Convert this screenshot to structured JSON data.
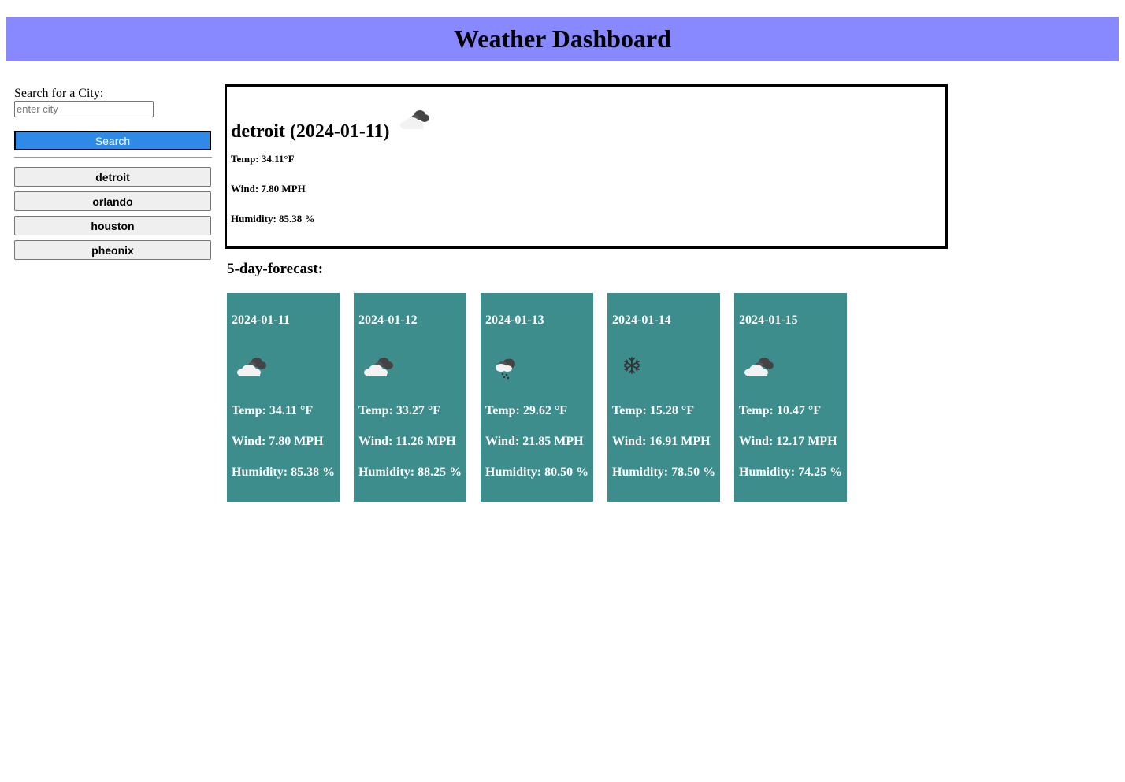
{
  "header": {
    "title": "Weather Dashboard"
  },
  "sidebar": {
    "search_label": "Search for a City:",
    "search_placeholder": "enter city",
    "search_button": "Search",
    "history": [
      "detroit",
      "orlando",
      "houston",
      "pheonix"
    ]
  },
  "current": {
    "title": "detroit (2024-01-11)",
    "icon": "cloudy-icon",
    "temp": "Temp: 34.11°F",
    "wind": "Wind: 7.80 MPH",
    "humidity": "Humidity: 85.38 %"
  },
  "forecast": {
    "heading": "5-day-forecast:",
    "days": [
      {
        "date": "2024-01-11",
        "icon": "cloudy-icon",
        "temp": "Temp: 34.11 °F",
        "wind": "Wind: 7.80 MPH",
        "humidity": "Humidity: 85.38 %"
      },
      {
        "date": "2024-01-12",
        "icon": "cloudy-icon",
        "temp": "Temp: 33.27 °F",
        "wind": "Wind: 11.26 MPH",
        "humidity": "Humidity: 88.25 %"
      },
      {
        "date": "2024-01-13",
        "icon": "snow-cloud-icon",
        "temp": "Temp: 29.62 °F",
        "wind": "Wind: 21.85 MPH",
        "humidity": "Humidity: 80.50 %"
      },
      {
        "date": "2024-01-14",
        "icon": "snowflake-icon",
        "temp": "Temp: 15.28 °F",
        "wind": "Wind: 16.91 MPH",
        "humidity": "Humidity: 78.50 %"
      },
      {
        "date": "2024-01-15",
        "icon": "cloudy-icon",
        "temp": "Temp: 10.47 °F",
        "wind": "Wind: 12.17 MPH",
        "humidity": "Humidity: 74.25 %"
      }
    ]
  },
  "colors": {
    "header_bg": "#8888ff",
    "search_button_bg": "#2e8ae6",
    "card_bg": "#3d8d8d"
  }
}
